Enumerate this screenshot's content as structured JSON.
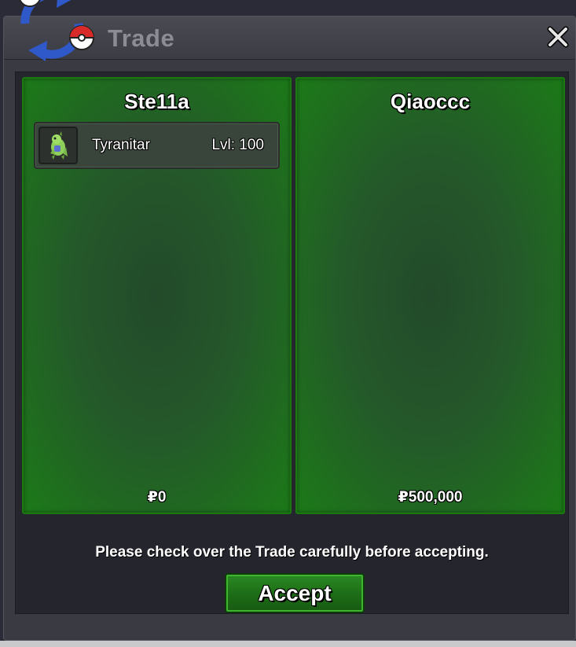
{
  "window": {
    "title": "Trade",
    "close_icon": "close-icon",
    "logo_icon": "trade-arrows-pokeball-icon"
  },
  "panels": [
    {
      "player": "Ste11a",
      "items": [
        {
          "name": "Tyranitar",
          "level": "Lvl: 100",
          "sprite_icon": "tyranitar-sprite-icon"
        }
      ],
      "money": "₽0"
    },
    {
      "player": "Qiaoccc",
      "items": [],
      "money": "₽500,000"
    }
  ],
  "notice": "Please check over the Trade carefully before accepting.",
  "accept_label": "Accept",
  "colors": {
    "panel_border": "#1a7a10",
    "panel_center": "#234a2a",
    "button_green": "#1d6c17",
    "title_gray": "#8c8c94"
  }
}
